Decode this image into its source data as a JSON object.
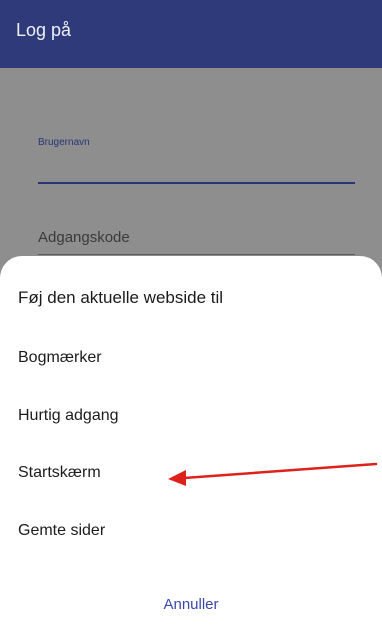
{
  "appbar": {
    "title": "Log på"
  },
  "form": {
    "username_label": "Brugernavn",
    "password_placeholder": "Adgangskode"
  },
  "sheet": {
    "title": "Føj den aktuelle webside til",
    "options": [
      {
        "label": "Bogmærker"
      },
      {
        "label": "Hurtig adgang"
      },
      {
        "label": "Startskærm"
      },
      {
        "label": "Gemte sider"
      }
    ],
    "cancel_label": "Annuller"
  },
  "colors": {
    "appbar": "#2e3a7a",
    "accent": "#283575",
    "cancel_text": "#3b48a7",
    "annotation_arrow": "#e0201b"
  }
}
